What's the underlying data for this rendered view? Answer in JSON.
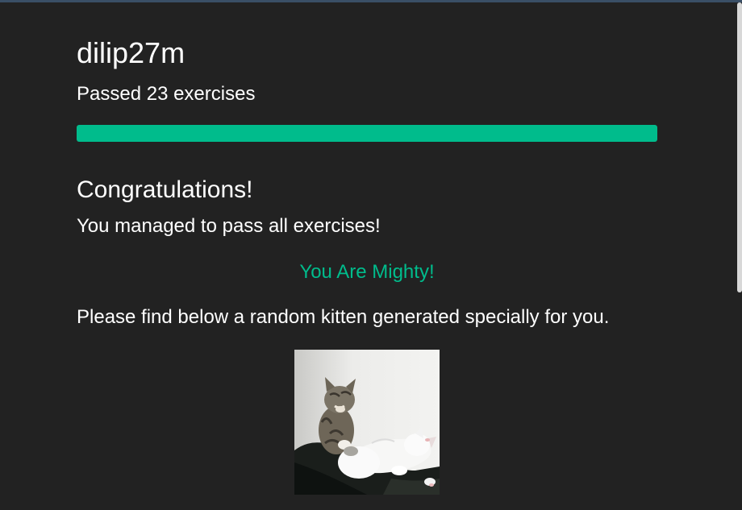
{
  "profile": {
    "username": "dilip27m",
    "passed_text": "Passed 23 exercises",
    "progress_fraction": 1.0
  },
  "result": {
    "heading": "Congratulations!",
    "message": "You managed to pass all exercises!",
    "badge": "You Are Mighty!",
    "kitten_text": "Please find below a random kitten generated specially for you."
  },
  "colors": {
    "background": "#222222",
    "accent": "#00bc8c",
    "text": "#ffffff"
  }
}
